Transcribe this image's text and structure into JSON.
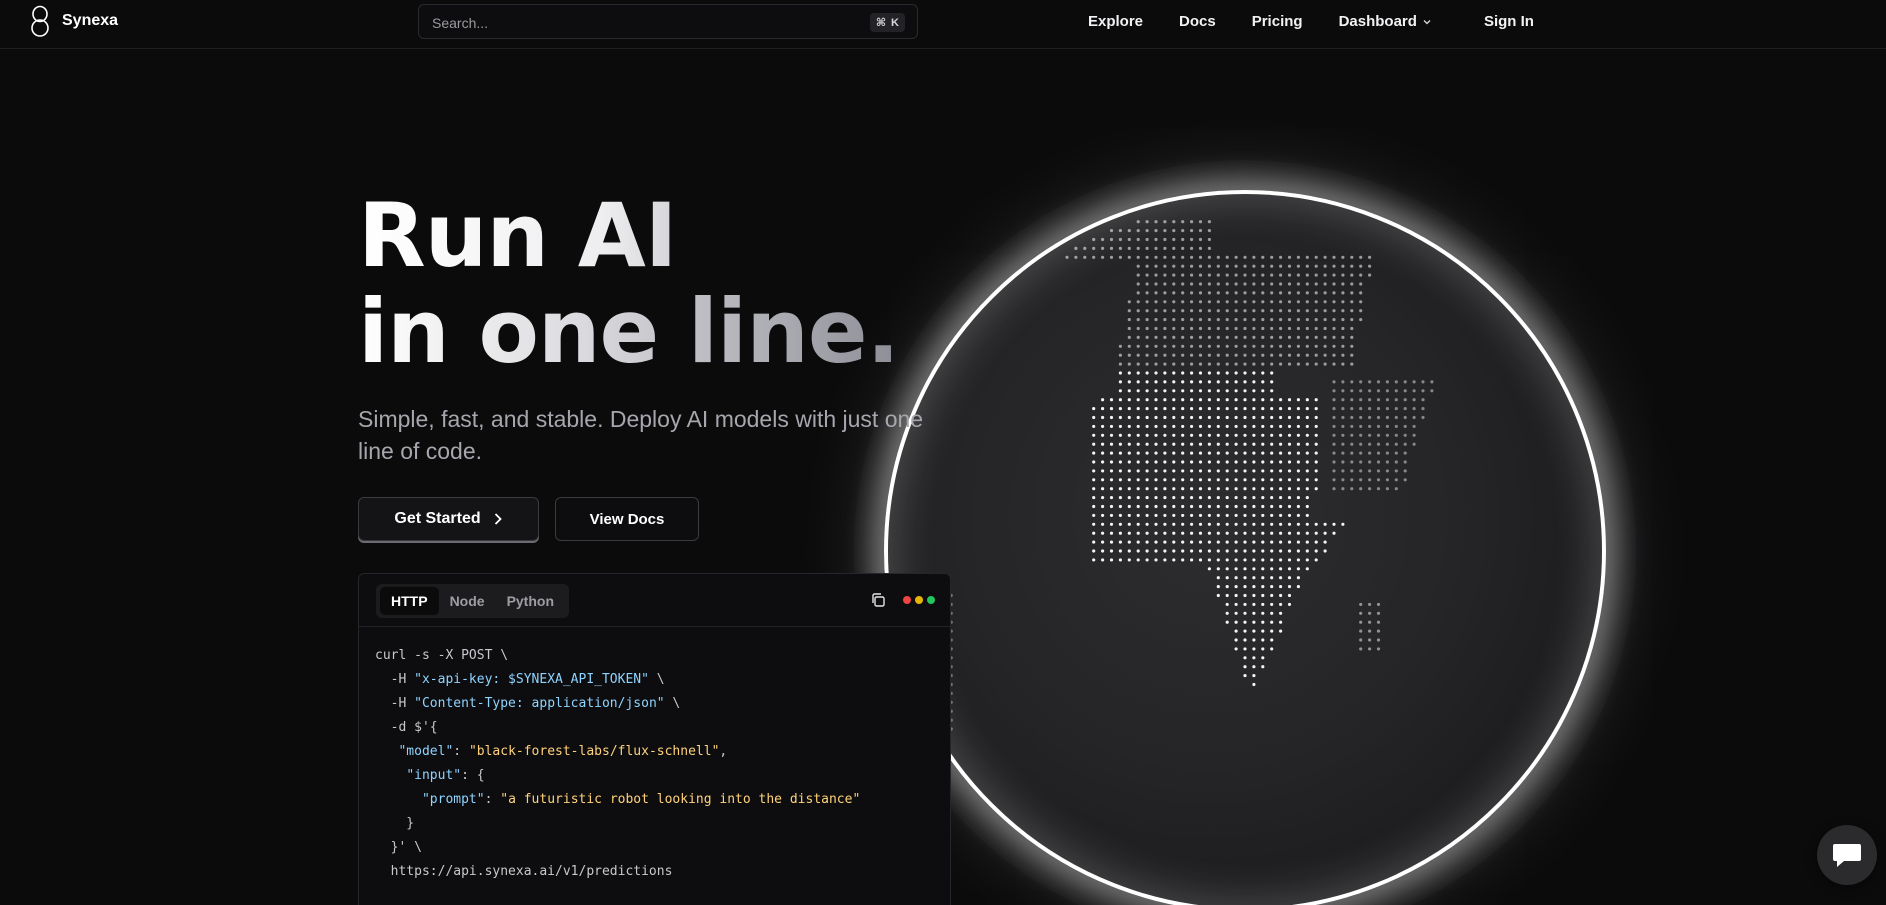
{
  "brand": {
    "name": "Synexa"
  },
  "search": {
    "placeholder": "Search...",
    "shortcut_symbol": "⌘",
    "shortcut_key": "K"
  },
  "nav": {
    "links": [
      "Explore",
      "Docs",
      "Pricing",
      "Dashboard"
    ],
    "sign_in": "Sign In"
  },
  "hero": {
    "headline_line1": "Run AI",
    "headline_line2": "in one line.",
    "subtitle": "Simple, fast, and stable. Deploy AI models with just one line of code.",
    "primary_button": "Get Started",
    "secondary_button": "View Docs"
  },
  "code": {
    "tabs": [
      "HTTP",
      "Node",
      "Python"
    ],
    "active_tab": "HTTP",
    "window_dot_colors": [
      "#ef4444",
      "#eab308",
      "#22c55e"
    ],
    "lines": [
      "curl -s -X POST \\",
      "  -H \"x-api-key: $SYNEXA_API_TOKEN\" \\",
      "  -H \"Content-Type: application/json\" \\",
      "  -d $'{",
      "   \"model\": \"black-forest-labs/flux-schnell\",",
      "    \"input\": {",
      "      \"prompt\": \"a futuristic robot looking into the distance\"",
      "    }",
      "  }' \\",
      "  https://api.synexa.ai/v1/predictions"
    ]
  },
  "icons": {
    "logo": "infinity-logo-icon",
    "search_shortcut": "command-icon",
    "dropdown": "chevron-down-icon",
    "button_arrow": "chevron-right-icon",
    "copy": "copy-icon",
    "chat": "chat-bubble-icon",
    "hero_art": "dotted-globe-illustration"
  },
  "colors": {
    "background": "#0b0b0c",
    "globe_rim": "#ffffff",
    "code_string": "#8fd3ff",
    "code_value": "#ffd27a"
  }
}
